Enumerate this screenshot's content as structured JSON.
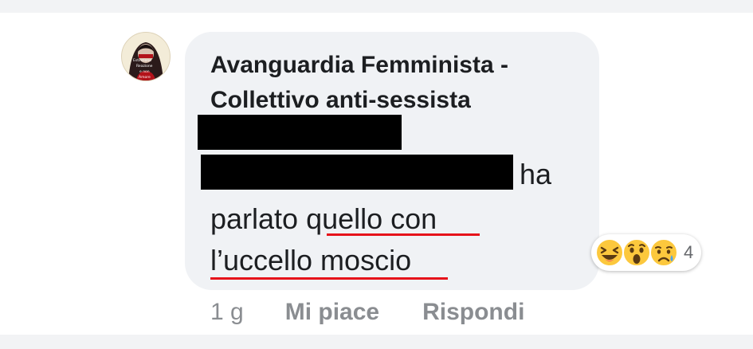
{
  "comment": {
    "author": "Avanguardia Femminista - Collettivo anti-sessista",
    "text_after_redaction": "ha",
    "text_line_2": {
      "before": "parlato ",
      "underlined": "quello con"
    },
    "text_line_3": {
      "underlined": "l’uccello moscio"
    },
    "redacted_blocks": 2,
    "highlight_color": "#e6131a"
  },
  "avatar": {
    "label_line_1": "Estinzione",
    "label_line_2": "Reazione",
    "label_line_3": "e non",
    "label_line_4": "Amore"
  },
  "reactions": {
    "icons": [
      "laughing-emoji-icon",
      "wow-emoji-icon",
      "sad-emoji-icon"
    ],
    "count": "4"
  },
  "actions": {
    "time": "1 g",
    "like": "Mi piace",
    "reply": "Rispondi"
  }
}
